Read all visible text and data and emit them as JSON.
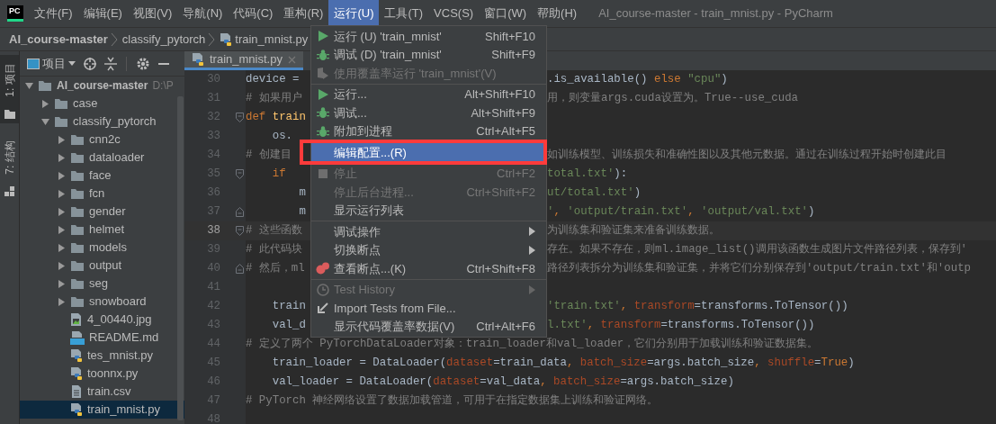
{
  "app_logo": "PC",
  "menu_bar": [
    {
      "label": "文件(F)",
      "selected": false
    },
    {
      "label": "编辑(E)",
      "selected": false
    },
    {
      "label": "视图(V)",
      "selected": false
    },
    {
      "label": "导航(N)",
      "selected": false
    },
    {
      "label": "代码(C)",
      "selected": false
    },
    {
      "label": "重构(R)",
      "selected": false
    },
    {
      "label": "运行(U)",
      "selected": true
    },
    {
      "label": "工具(T)",
      "selected": false
    },
    {
      "label": "VCS(S)",
      "selected": false
    },
    {
      "label": "窗口(W)",
      "selected": false
    },
    {
      "label": "帮助(H)",
      "selected": false
    }
  ],
  "window_title": "AI_course-master - train_mnist.py - PyCharm",
  "breadcrumbs": [
    {
      "label": "AI_course-master",
      "kind": "project"
    },
    {
      "label": "classify_pytorch",
      "kind": "folder"
    },
    {
      "label": "train_mnist.py",
      "kind": "python"
    }
  ],
  "tool_strip": [
    {
      "label": "1: 项目",
      "kind": "project",
      "selected": true
    },
    {
      "label": "7: 结构",
      "kind": "structure",
      "selected": false
    }
  ],
  "project_pane": {
    "view": "项目"
  },
  "tree": [
    {
      "name": "AI_course-master",
      "path": "D:\\P",
      "kind": "folder",
      "expanded": true,
      "selected": false,
      "children": [
        {
          "name": "case",
          "kind": "folder",
          "expanded": false,
          "selected": false
        },
        {
          "name": "classify_pytorch",
          "kind": "folder",
          "expanded": true,
          "selected": false,
          "children": [
            {
              "name": "cnn2c",
              "kind": "folder",
              "expanded": false,
              "selected": false
            },
            {
              "name": "dataloader",
              "kind": "folder",
              "expanded": false,
              "selected": false
            },
            {
              "name": "face",
              "kind": "folder",
              "expanded": false,
              "selected": false
            },
            {
              "name": "fcn",
              "kind": "folder",
              "expanded": false,
              "selected": false
            },
            {
              "name": "gender",
              "kind": "folder",
              "expanded": false,
              "selected": false
            },
            {
              "name": "helmet",
              "kind": "folder",
              "expanded": false,
              "selected": false
            },
            {
              "name": "models",
              "kind": "folder",
              "expanded": false,
              "selected": false
            },
            {
              "name": "output",
              "kind": "folder",
              "expanded": false,
              "selected": false
            },
            {
              "name": "seg",
              "kind": "folder",
              "expanded": false,
              "selected": false
            },
            {
              "name": "snowboard",
              "kind": "folder",
              "expanded": false,
              "selected": false
            },
            {
              "name": "4_00440.jpg",
              "kind": "image",
              "selected": false
            },
            {
              "name": "README.md",
              "kind": "markdown",
              "selected": false
            },
            {
              "name": "tes_mnist.py",
              "kind": "python",
              "selected": false
            },
            {
              "name": "toonnx.py",
              "kind": "python",
              "selected": false
            },
            {
              "name": "train.csv",
              "kind": "text",
              "selected": false
            },
            {
              "name": "train_mnist.py",
              "kind": "python",
              "selected": true
            }
          ]
        }
      ]
    }
  ],
  "editor_tabs": [
    {
      "label": "train_mnist.py",
      "selected": true
    }
  ],
  "code_lines": [
    {
      "number": "30",
      "current": false,
      "fold_start": false,
      "fold_end": false,
      "left": [
        {
          "text": "device = ",
          "kind": "plain"
        }
      ],
      "right": [
        {
          "text": ".is_available() ",
          "kind": "plain"
        },
        {
          "text": "else",
          "kind": "keyword"
        },
        {
          "text": " \"cpu\"",
          "kind": "string"
        },
        {
          "text": ")",
          "kind": "plain"
        }
      ]
    },
    {
      "number": "31",
      "current": false,
      "fold_start": false,
      "fold_end": false,
      "left": [
        {
          "text": "# 如果用户",
          "kind": "comment"
        }
      ],
      "right": [
        {
          "text": "用，则变量args.cuda设置为。True--use_cuda",
          "kind": "comment"
        }
      ]
    },
    {
      "number": "32",
      "current": false,
      "fold_start": true,
      "fold_end": false,
      "left": [
        {
          "text": "def",
          "kind": "keyword"
        },
        {
          "text": " train",
          "kind": "function"
        }
      ]
    },
    {
      "number": "33",
      "current": false,
      "fold_start": false,
      "fold_end": false,
      "left": [
        {
          "text": "    os.",
          "kind": "plain"
        }
      ]
    },
    {
      "number": "34",
      "current": false,
      "fold_start": false,
      "fold_end": false,
      "left": [
        {
          "text": "# 创建目",
          "kind": "comment"
        }
      ],
      "right": [
        {
          "text": "如训练模型、训练损失和准确性图以及其他元数据。通过在训练过程开始时创建此目",
          "kind": "comment"
        }
      ]
    },
    {
      "number": "35",
      "current": false,
      "fold_start": true,
      "fold_end": false,
      "left": [
        {
          "text": "    if",
          "kind": "keyword"
        }
      ],
      "right": [
        {
          "text": "total.txt'",
          "kind": "string"
        },
        {
          "text": "):",
          "kind": "plain"
        }
      ]
    },
    {
      "number": "36",
      "current": false,
      "fold_start": false,
      "fold_end": false,
      "left": [
        {
          "text": "        m",
          "kind": "plain"
        }
      ],
      "right": [
        {
          "text": "ut/total.txt'",
          "kind": "string"
        },
        {
          "text": ")",
          "kind": "plain"
        }
      ]
    },
    {
      "number": "37",
      "current": false,
      "fold_start": false,
      "fold_end": true,
      "left": [
        {
          "text": "        m",
          "kind": "plain"
        }
      ],
      "right": [
        {
          "text": "'",
          "kind": "string"
        },
        {
          "text": ", ",
          "kind": "delimiter"
        },
        {
          "text": "'output/train.txt'",
          "kind": "string"
        },
        {
          "text": ", ",
          "kind": "delimiter"
        },
        {
          "text": "'output/val.txt'",
          "kind": "string"
        },
        {
          "text": ")",
          "kind": "plain"
        }
      ]
    },
    {
      "number": "38",
      "current": true,
      "fold_start": true,
      "fold_end": false,
      "left": [
        {
          "text": "# 这些函数",
          "kind": "comment"
        }
      ],
      "right": [
        {
          "text": "为训练集和验证集来准备训练数据。",
          "kind": "comment"
        }
      ]
    },
    {
      "number": "39",
      "current": false,
      "fold_start": false,
      "fold_end": false,
      "left": [
        {
          "text": "# 此代码块",
          "kind": "comment"
        }
      ],
      "right": [
        {
          "text": "存在。如果不存在，则ml.image_list()调用该函数生成图片文件路径列表，保存到'",
          "kind": "comment"
        }
      ]
    },
    {
      "number": "40",
      "current": false,
      "fold_start": false,
      "fold_end": true,
      "left": [
        {
          "text": "# 然后，ml",
          "kind": "comment"
        }
      ],
      "right": [
        {
          "text": "路径列表拆分为训练集和验证集，并将它们分别保存到'output/train.txt'和'outp",
          "kind": "comment"
        }
      ]
    },
    {
      "number": "41",
      "current": false,
      "fold_start": false,
      "fold_end": false
    },
    {
      "number": "42",
      "current": false,
      "fold_start": false,
      "fold_end": false,
      "left": [
        {
          "text": "    train",
          "kind": "plain"
        }
      ],
      "right": [
        {
          "text": "'train.txt'",
          "kind": "string"
        },
        {
          "text": ", ",
          "kind": "delimiter"
        },
        {
          "text": "transform",
          "kind": "param"
        },
        {
          "text": "=transforms.ToTensor())",
          "kind": "plain"
        }
      ]
    },
    {
      "number": "43",
      "current": false,
      "fold_start": false,
      "fold_end": false,
      "left": [
        {
          "text": "    val_d",
          "kind": "plain"
        }
      ],
      "right": [
        {
          "text": "l.txt'",
          "kind": "string"
        },
        {
          "text": ", ",
          "kind": "delimiter"
        },
        {
          "text": "transform",
          "kind": "param"
        },
        {
          "text": "=transforms.ToTensor())",
          "kind": "plain"
        }
      ]
    },
    {
      "number": "44",
      "current": false,
      "fold_start": false,
      "fold_end": false,
      "left": [
        {
          "text": "# 定义了两个 PyTorchDataLoader对象：train_loader和val_loader，它们分别用于加载训练和验证数据集。",
          "kind": "comment"
        }
      ]
    },
    {
      "number": "45",
      "current": false,
      "fold_start": false,
      "fold_end": false,
      "left": [
        {
          "text": "    train_loader = DataLoader(",
          "kind": "plain"
        },
        {
          "text": "dataset",
          "kind": "param"
        },
        {
          "text": "=train_data",
          "kind": "plain"
        },
        {
          "text": ", ",
          "kind": "delimiter"
        },
        {
          "text": "batch_size",
          "kind": "param"
        },
        {
          "text": "=args.batch_size",
          "kind": "plain"
        },
        {
          "text": ", ",
          "kind": "delimiter"
        },
        {
          "text": "shuffle",
          "kind": "param"
        },
        {
          "text": "=",
          "kind": "plain"
        },
        {
          "text": "True",
          "kind": "keyword"
        },
        {
          "text": ")",
          "kind": "plain"
        }
      ]
    },
    {
      "number": "46",
      "current": false,
      "fold_start": false,
      "fold_end": false,
      "left": [
        {
          "text": "    val_loader = DataLoader(",
          "kind": "plain"
        },
        {
          "text": "dataset",
          "kind": "param"
        },
        {
          "text": "=val_data",
          "kind": "plain"
        },
        {
          "text": ", ",
          "kind": "delimiter"
        },
        {
          "text": "batch_size",
          "kind": "param"
        },
        {
          "text": "=args.batch_size)",
          "kind": "plain"
        }
      ]
    },
    {
      "number": "47",
      "current": false,
      "fold_start": false,
      "fold_end": false,
      "left": [
        {
          "text": "# PyTorch 神经网络设置了数据加载管道，可用于在指定数据集上训练和验证网络。",
          "kind": "comment"
        }
      ]
    },
    {
      "number": "48",
      "current": false,
      "fold_start": false,
      "fold_end": false
    }
  ],
  "run_menu": [
    {
      "kind": "run",
      "label": "运行 (U) 'train_mnist'",
      "shortcut": "Shift+F10",
      "disabled": false,
      "selected": false
    },
    {
      "kind": "debug",
      "label": "调试 (D) 'train_mnist'",
      "shortcut": "Shift+F9",
      "disabled": false,
      "selected": false
    },
    {
      "kind": "coverage",
      "label": "使用覆盖率运行 'train_mnist'(V)",
      "disabled": true,
      "selected": false
    },
    {
      "kind": "separator"
    },
    {
      "kind": "run",
      "label": "运行...",
      "shortcut": "Alt+Shift+F10",
      "disabled": false,
      "selected": false
    },
    {
      "kind": "debug",
      "label": "调试...",
      "shortcut": "Alt+Shift+F9",
      "disabled": false,
      "selected": false
    },
    {
      "kind": "debug",
      "label": "附加到进程",
      "shortcut": "Ctrl+Alt+F5",
      "disabled": false,
      "selected": false
    },
    {
      "kind": "separator"
    },
    {
      "kind": "plain",
      "label": "编辑配置...(R)",
      "disabled": false,
      "selected": true
    },
    {
      "kind": "separator"
    },
    {
      "kind": "stop",
      "label": "停止",
      "shortcut": "Ctrl+F2",
      "disabled": true,
      "selected": false
    },
    {
      "kind": "plain",
      "label": "停止后台进程...",
      "shortcut": "Ctrl+Shift+F2",
      "disabled": true,
      "selected": false
    },
    {
      "kind": "plain",
      "label": "显示运行列表",
      "disabled": false,
      "selected": false
    },
    {
      "kind": "separator"
    },
    {
      "kind": "plain",
      "label": "调试操作",
      "submenu": true,
      "disabled": false,
      "selected": false
    },
    {
      "kind": "plain",
      "label": "切换断点",
      "submenu": true,
      "disabled": false,
      "selected": false
    },
    {
      "kind": "breakpoints",
      "label": "查看断点...(K)",
      "shortcut": "Ctrl+Shift+F8",
      "disabled": false,
      "selected": false
    },
    {
      "kind": "separator"
    },
    {
      "kind": "history",
      "label": "Test History",
      "submenu": true,
      "disabled": true,
      "selected": false
    },
    {
      "kind": "import",
      "label": "Import Tests from File...",
      "disabled": false,
      "selected": false
    },
    {
      "kind": "plain",
      "label": "显示代码覆盖率数据(V)",
      "shortcut": "Ctrl+Alt+F6",
      "disabled": false,
      "selected": false
    }
  ]
}
